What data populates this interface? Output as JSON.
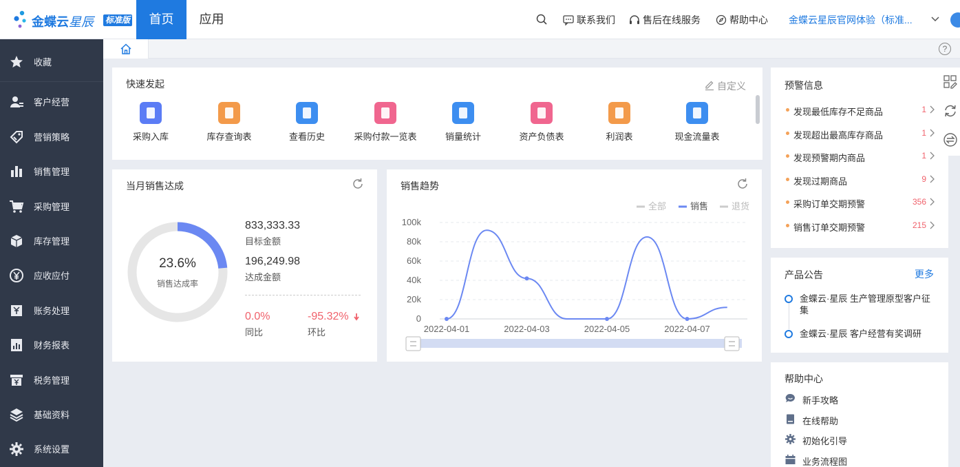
{
  "app": {
    "brand_name": "金蝶云",
    "brand_suffix": "星辰",
    "edition_badge": "标准版"
  },
  "topnav": {
    "home": "首页",
    "apps": "应用",
    "contact": "联系我们",
    "service": "售后在线服务",
    "help": "帮助中心",
    "account": "金蝶云星辰官网体验（标准..."
  },
  "sidebar": {
    "items": [
      {
        "label": "收藏",
        "icon": "star-icon"
      },
      {
        "label": "客户经营",
        "icon": "customer-icon"
      },
      {
        "label": "营销策略",
        "icon": "tag-icon"
      },
      {
        "label": "销售管理",
        "icon": "bar-chart-icon"
      },
      {
        "label": "采购管理",
        "icon": "cart-icon"
      },
      {
        "label": "库存管理",
        "icon": "box-icon"
      },
      {
        "label": "应收应付",
        "icon": "yen-coin-icon"
      },
      {
        "label": "账务处理",
        "icon": "ledger-icon"
      },
      {
        "label": "财务报表",
        "icon": "report-icon"
      },
      {
        "label": "税务管理",
        "icon": "tax-icon"
      },
      {
        "label": "基础资料",
        "icon": "layers-icon"
      },
      {
        "label": "系统设置",
        "icon": "gear-icon"
      }
    ]
  },
  "quick": {
    "title": "快速发起",
    "customize": "自定义",
    "items": [
      {
        "label": "采购入库",
        "color": "#5b7cf5"
      },
      {
        "label": "库存查询表",
        "color": "#f39a4a"
      },
      {
        "label": "查看历史",
        "color": "#3d8ef0"
      },
      {
        "label": "采购付款一览表",
        "color": "#f0668f"
      },
      {
        "label": "销量统计",
        "color": "#3d8ef0"
      },
      {
        "label": "资产负债表",
        "color": "#f0668f"
      },
      {
        "label": "利润表",
        "color": "#f39a4a"
      },
      {
        "label": "现金流量表",
        "color": "#3d8ef0"
      }
    ]
  },
  "target": {
    "title": "当月销售达成",
    "rate": "23.6%",
    "rate_value": 0.236,
    "rate_label": "销售达成率",
    "target_amount": "833,333.33",
    "target_label": "目标金额",
    "achieved_amount": "196,249.98",
    "achieved_label": "达成金额",
    "yoy": "0.0%",
    "yoy_label": "同比",
    "mom": "-95.32%",
    "mom_label": "环比",
    "accent": "#6b88f2",
    "track": "#e6e6e6"
  },
  "trend": {
    "title": "销售趋势"
  },
  "chart_data": {
    "type": "line",
    "x": [
      "2022-04-01",
      "2022-04-02",
      "2022-04-03",
      "2022-04-04",
      "2022-04-05",
      "2022-04-06",
      "2022-04-07",
      "2022-04-08"
    ],
    "x_tick_labels": [
      "2022-04-01",
      "2022-04-03",
      "2022-04-05",
      "2022-04-07"
    ],
    "y_tick_labels": [
      "100k",
      "80k",
      "60k",
      "40k",
      "20k",
      "0"
    ],
    "ylim": [
      0,
      100000
    ],
    "legend": [
      "全部",
      "销售",
      "退货"
    ],
    "legend_position": "top-right",
    "series": [
      {
        "name": "销售",
        "values": [
          0,
          92000,
          42000,
          0,
          0,
          85000,
          0,
          12000
        ],
        "color": "#6b88f2"
      }
    ],
    "grid": true
  },
  "alerts": {
    "title": "预警信息",
    "items": [
      {
        "text": "发现最低库存不足商品",
        "count": "1"
      },
      {
        "text": "发现超出最高库存商品",
        "count": "1"
      },
      {
        "text": "发现预警期内商品",
        "count": "1"
      },
      {
        "text": "发现过期商品",
        "count": "9"
      },
      {
        "text": "采购订单交期预警",
        "count": "356"
      },
      {
        "text": "销售订单交期预警",
        "count": "215"
      }
    ]
  },
  "news": {
    "title": "产品公告",
    "more": "更多",
    "items": [
      {
        "line1": "金蝶云·星辰 生产管理原型客户征",
        "line2": "集"
      },
      {
        "line1": "金蝶云·星辰 客户经营有奖调研",
        "line2": ""
      }
    ]
  },
  "helpcenter": {
    "title": "帮助中心",
    "items": [
      {
        "label": "新手攻略",
        "icon": "chat-bubble-icon"
      },
      {
        "label": "在线帮助",
        "icon": "book-icon"
      },
      {
        "label": "初始化引导",
        "icon": "gear-icon"
      },
      {
        "label": "业务流程图",
        "icon": "calendar-icon"
      }
    ]
  }
}
